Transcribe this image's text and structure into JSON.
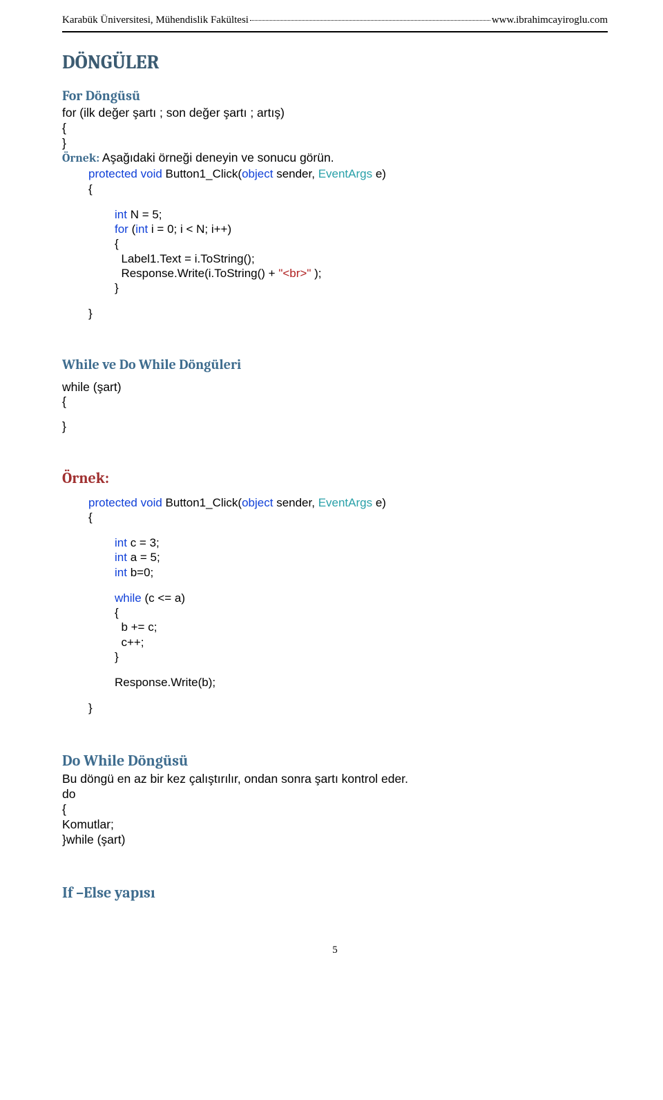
{
  "header": {
    "left": "Karabük Üniversitesi, Mühendislik Fakültesi",
    "right": "www.ibrahimcayiroglu.com"
  },
  "title_donguler": "DÖNGÜLER",
  "for_section": {
    "heading": "For Döngüsü",
    "line1": "for (ilk değer şartı ; son değer şartı ; artış)",
    "brace_open": "{",
    "brace_close": "}",
    "ornek_lbl": "Örnek:",
    "ornek_txt": " Aşağıdaki örneği deneyin ve sonucu görün.",
    "code": {
      "protected": "protected",
      "void": " void",
      "method": " Button1_Click(",
      "object": "object",
      "sender_args": " sender, ",
      "eventargs": "EventArgs",
      "e_paren": " e)",
      "open": "{",
      "int_kw": "int",
      "n_decl": " N = 5;",
      "for_kw": "for",
      "for_args_pre": " (",
      "i_decl": " i = 0; i < N; i++)",
      "inner_open": "{",
      "label_txt": "Label1.Text = i.ToString();",
      "resp_pre": "Response.Write(i.ToString() + ",
      "br_str": "\"<br>\"",
      "resp_post": " );",
      "inner_close": "}",
      "outer_close": "}"
    }
  },
  "while_section": {
    "heading": "While ve Do While Döngüleri",
    "line1": "while (şart)",
    "brace_open": "{",
    "brace_close": "}"
  },
  "ornek2": {
    "heading": "Örnek:",
    "code": {
      "protected": "protected",
      "void": " void",
      "method": " Button1_Click(",
      "object": "object",
      "sender_args": " sender, ",
      "eventargs": "EventArgs",
      "e_paren": " e)",
      "open": "{",
      "int_kw": "int",
      "c_decl": " c = 3;",
      "a_decl": " a = 5;",
      "b_decl": " b=0;",
      "while_kw": "while",
      "while_cond": " (c <= a)",
      "inner_open": "{",
      "b_plus": "b += c;",
      "c_plus": "c++;",
      "inner_close": "}",
      "resp": "Response.Write(b);",
      "outer_close": "}"
    }
  },
  "do_while": {
    "heading": "Do While Döngüsü",
    "desc": "Bu döngü en az bir kez çalıştırılır, ondan sonra şartı kontrol eder.",
    "do_line": "do",
    "open": "{",
    "komutlar": "Komutlar;",
    "close_while": "}while (şart)"
  },
  "if_else": {
    "heading": "If –Else yapısı"
  },
  "page_number": "5"
}
